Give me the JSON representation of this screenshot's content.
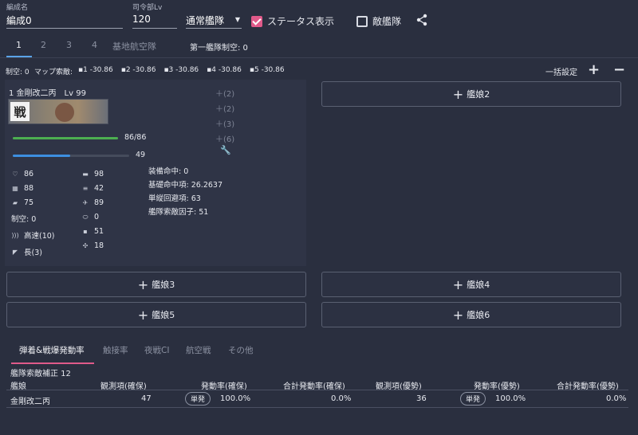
{
  "header": {
    "fleet_name_label": "編成名",
    "fleet_name_value": "編成0",
    "hq_level_label": "司令部Lv",
    "hq_level_value": "120",
    "fleet_type": "通常艦隊",
    "status_display_label": "ステータス表示",
    "enemy_fleet_label": "敵艦隊"
  },
  "tabs": [
    "1",
    "2",
    "3",
    "4",
    "基地航空隊"
  ],
  "fleet_air_control": "第一艦隊制空: 0",
  "summary": {
    "air": "制空: 0",
    "map_los": "マップ索敵:",
    "los_values": [
      "1 -30.86",
      "2 -30.86",
      "3 -30.86",
      "4 -30.86",
      "5 -30.86"
    ],
    "bulk_settings": "一括設定"
  },
  "ship1": {
    "title": "1 金剛改二丙　Lv 99",
    "badge": "戦",
    "hp": "86/86",
    "hp_fraction": 1.0,
    "morale": "49",
    "morale_fraction": 0.49,
    "slots": [
      "(2)",
      "(2)",
      "(3)",
      "(6)"
    ],
    "stats_left": [
      {
        "icon": "heart-icon",
        "value": "86"
      },
      {
        "icon": "armor-icon",
        "value": "88"
      },
      {
        "icon": "firepower-icon",
        "value": "75"
      },
      {
        "icon": "",
        "value": "制空: 0"
      },
      {
        "icon": "speed-icon",
        "value": "高速(10)"
      },
      {
        "icon": "range-icon",
        "value": "長(3)"
      }
    ],
    "stats_right": [
      {
        "icon": "torpedo-icon",
        "value": "98"
      },
      {
        "icon": "evasion-icon",
        "value": "42"
      },
      {
        "icon": "aa-icon",
        "value": "89"
      },
      {
        "icon": "aircraft-icon",
        "value": "0"
      },
      {
        "icon": "asw-icon",
        "value": "51"
      },
      {
        "icon": "los-icon",
        "value": "18"
      }
    ],
    "details": [
      "装備命中: 0",
      "基礎命中項: 26.2637",
      "単縦回避項: 63",
      "艦隊索敵因子: 51"
    ]
  },
  "slots_buttons": {
    "ship2": "艦娘2",
    "ship3": "艦娘3",
    "ship4": "艦娘4",
    "ship5": "艦娘5",
    "ship6": "艦娘6"
  },
  "bottom_tabs": [
    "弾着&戦爆発動率",
    "触接率",
    "夜戦CI",
    "航空戦",
    "その他"
  ],
  "table": {
    "fleet_los_correction": "艦隊索敵補正 12",
    "headers": [
      "艦娘",
      "観測項(確保)",
      "発動率(確保)",
      "合計発動率(確保)",
      "観測項(優勢)",
      "発動率(優勢)",
      "合計発動率(優勢)"
    ],
    "row": {
      "name": "金剛改二丙",
      "obs_secure": "47",
      "type_secure": "単発",
      "rate_secure": "100.0%",
      "total_secure": "0.0%",
      "obs_superior": "36",
      "type_superior": "単発",
      "rate_superior": "100.0%",
      "total_superior": "0.0%"
    }
  }
}
